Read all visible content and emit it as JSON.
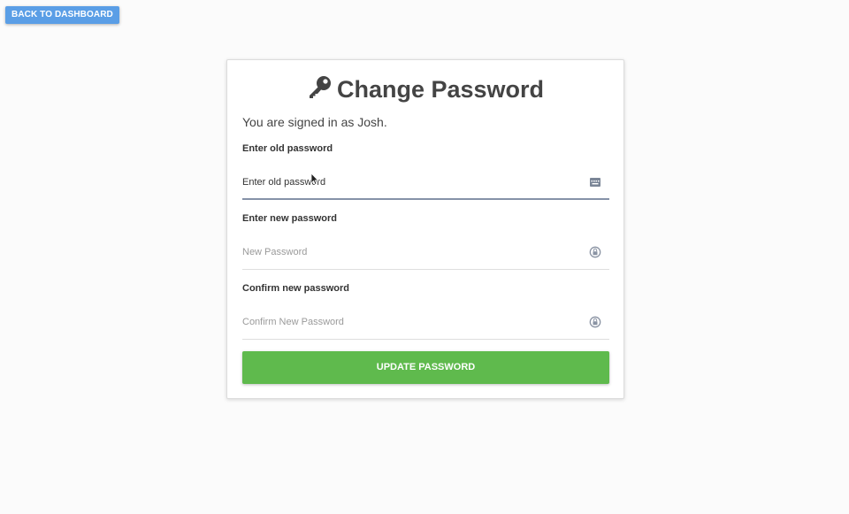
{
  "nav": {
    "back_label": "BACK TO DASHBOARD"
  },
  "card": {
    "title": "Change Password",
    "title_icon": "key-icon",
    "signed_in_text": "You are signed in as Josh."
  },
  "fields": [
    {
      "label": "Enter old password",
      "value": "Enter old password",
      "placeholder": "",
      "icon": "keyboard-icon"
    },
    {
      "label": "Enter new password",
      "value": "",
      "placeholder": "New Password",
      "icon": "lock-icon"
    },
    {
      "label": "Confirm new password",
      "value": "",
      "placeholder": "Confirm New Password",
      "icon": "lock-icon"
    }
  ],
  "submit": {
    "label": "UPDATE PASSWORD"
  },
  "colors": {
    "accent_blue": "#5a9ee6",
    "submit_green": "#5fba4d",
    "focus_underline": "#8592a8"
  }
}
